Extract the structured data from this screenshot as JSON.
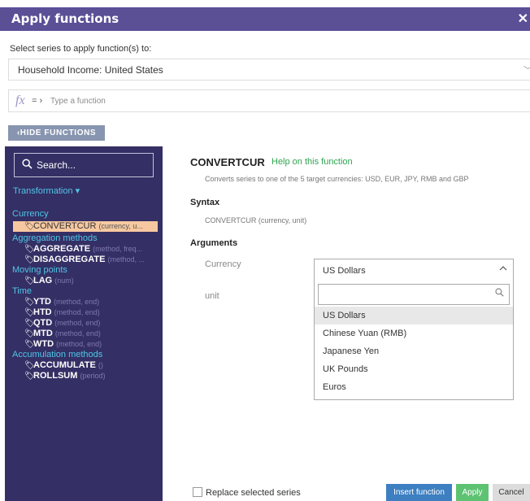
{
  "dialog": {
    "title": "Apply functions",
    "close_glyph": "✕"
  },
  "series": {
    "label": "Select series to apply function(s) to:",
    "selected": "Household Income: United States",
    "chevron": "﹀"
  },
  "fx_bar": {
    "fx_glyph": "fx",
    "arrow": "= ›",
    "placeholder": "Type a function"
  },
  "hide_functions": "‹HIDE FUNCTIONS",
  "sidebar": {
    "search_placeholder": "Search...",
    "transformation": "Transformation ▾",
    "groups": [
      {
        "label": "Currency",
        "items": [
          {
            "name": "CONVERTCUR",
            "args": "(currency, u...",
            "active": true
          }
        ]
      },
      {
        "label": "Aggregation methods",
        "items": [
          {
            "name": "AGGREGATE",
            "args": "(method, freq..."
          },
          {
            "name": "DISAGGREGATE",
            "args": "(method, ..."
          }
        ]
      },
      {
        "label": "Moving points",
        "items": [
          {
            "name": "LAG",
            "args": "(num)"
          }
        ]
      },
      {
        "label": "Time",
        "items": [
          {
            "name": "YTD",
            "args": "(method, end)"
          },
          {
            "name": "HTD",
            "args": "(method, end)"
          },
          {
            "name": "QTD",
            "args": "(method, end)"
          },
          {
            "name": "MTD",
            "args": "(method, end)"
          },
          {
            "name": "WTD",
            "args": "(method, end)"
          }
        ]
      },
      {
        "label": "Accumulation methods",
        "items": [
          {
            "name": "ACCUMULATE",
            "args": "()"
          },
          {
            "name": "ROLLSUM",
            "args": "(period)"
          }
        ]
      }
    ]
  },
  "detail": {
    "function_name": "CONVERTCUR",
    "help_link": "Help on this function",
    "description": "Converts series to one of the 5 target currencies: USD, EUR, JPY, RMB and GBP",
    "syntax_heading": "Syntax",
    "syntax": "CONVERTCUR (currency, unit)",
    "arguments_heading": "Arguments",
    "arg_currency_label": "Currency",
    "arg_unit_label": "unit",
    "currency_selected": "US Dollars",
    "currency_options": [
      "US Dollars",
      "Chinese Yuan (RMB)",
      "Japanese Yen",
      "UK Pounds",
      "Euros"
    ]
  },
  "footer": {
    "replace_label": "Replace selected series",
    "insert_label": "Insert function",
    "apply_label": "Apply",
    "cancel_label": "Cancel"
  },
  "colors": {
    "titlebar": "#5b4f96",
    "sidebar": "#342f64",
    "category": "#4fc6e8",
    "active_item": "#f7c8a0",
    "insert": "#3d7fc1",
    "apply": "#5ec273",
    "help_link": "#2ea44f"
  },
  "icons": {
    "close": "close-icon",
    "search": "search-icon",
    "chevron": "chevron-down-icon",
    "tag": "tag-icon"
  }
}
